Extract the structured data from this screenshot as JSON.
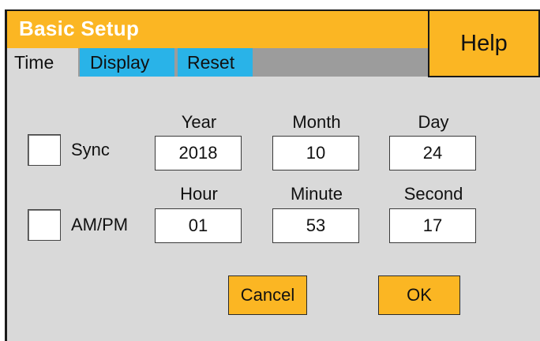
{
  "window": {
    "title": "Basic Setup",
    "help_label": "Help"
  },
  "tabs": [
    {
      "label": "Time",
      "active": true
    },
    {
      "label": "Display",
      "active": false
    },
    {
      "label": "Reset",
      "active": false
    }
  ],
  "options": {
    "sync_label": "Sync",
    "sync_checked": false,
    "ampm_label": "AM/PM",
    "ampm_checked": false
  },
  "date": {
    "year_label": "Year",
    "year": "2018",
    "month_label": "Month",
    "month": "10",
    "day_label": "Day",
    "day": "24"
  },
  "time": {
    "hour_label": "Hour",
    "hour": "01",
    "minute_label": "Minute",
    "minute": "53",
    "second_label": "Second",
    "second": "17"
  },
  "actions": {
    "cancel_label": "Cancel",
    "ok_label": "OK"
  },
  "colors": {
    "accent": "#fbb623",
    "tab_blue": "#29b3e8",
    "panel": "#d9d9d9",
    "tabstrip": "#9c9c9c"
  }
}
